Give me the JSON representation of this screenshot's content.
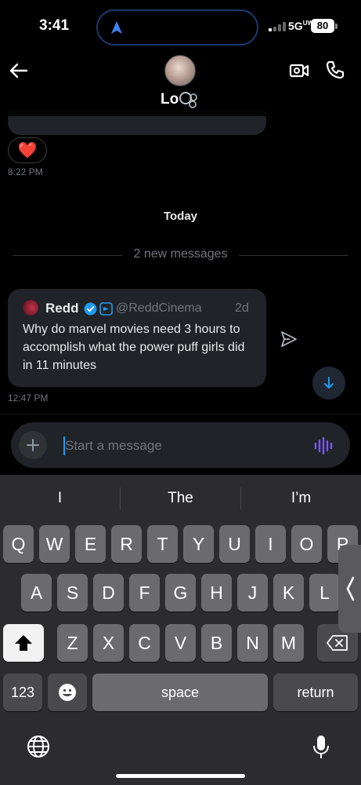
{
  "status_bar": {
    "time": "3:41",
    "network": "5G",
    "network_sub": "UW",
    "battery": "80"
  },
  "header": {
    "contact_name": "Lo"
  },
  "messages": {
    "reaction": "❤️",
    "earlier_time": "8:22 PM",
    "day_label": "Today",
    "new_messages_label": "2 new messages",
    "shared_post": {
      "author": "Redd",
      "handle": "@ReddCinema",
      "age": "2d",
      "text": "Why do marvel movies need 3 hours to accomplish what the power puff girls did in 11 minutes"
    },
    "latest_time": "12:47 PM"
  },
  "composer": {
    "placeholder": "Start a message"
  },
  "keyboard": {
    "suggestions": [
      "I",
      "The",
      "I’m"
    ],
    "row1": [
      "Q",
      "W",
      "E",
      "R",
      "T",
      "Y",
      "U",
      "I",
      "O",
      "P"
    ],
    "row2": [
      "A",
      "S",
      "D",
      "F",
      "G",
      "H",
      "J",
      "K",
      "L"
    ],
    "row3": [
      "Z",
      "X",
      "C",
      "V",
      "B",
      "N",
      "M"
    ],
    "numbers_label": "123",
    "space_label": "space",
    "return_label": "return"
  },
  "colors": {
    "accent": "#1d9bf0",
    "background": "#000000",
    "bubble": "#202327",
    "heart": "#f4212e"
  }
}
